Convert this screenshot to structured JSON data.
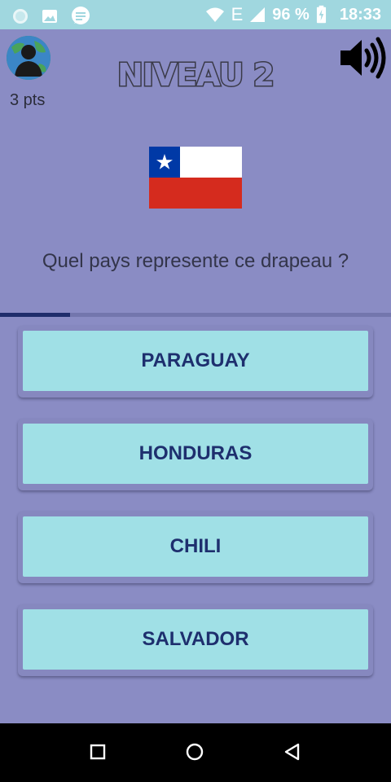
{
  "status_bar": {
    "battery": "96 %",
    "network": "E",
    "time": "18:33"
  },
  "header": {
    "points": "3 pts",
    "level_title": "NIVEAU 2"
  },
  "quiz": {
    "question": "Quel pays represente ce drapeau ?",
    "progress": 0.18,
    "answers": [
      {
        "label": "PARAGUAY"
      },
      {
        "label": "HONDURAS"
      },
      {
        "label": "CHILI"
      },
      {
        "label": "SALVADOR"
      }
    ]
  },
  "colors": {
    "background": "#8a8cc4",
    "answer_fill": "#a0e0e6",
    "answer_text": "#1e2f6e",
    "status_bar": "#a0d7df"
  },
  "icons": [
    "notification-circle-icon",
    "image-icon",
    "message-icon",
    "wifi-icon",
    "signal-icon",
    "battery-icon",
    "avatar-icon",
    "speaker-icon",
    "chile-flag",
    "nav-square-icon",
    "nav-home-icon",
    "nav-back-icon"
  ]
}
